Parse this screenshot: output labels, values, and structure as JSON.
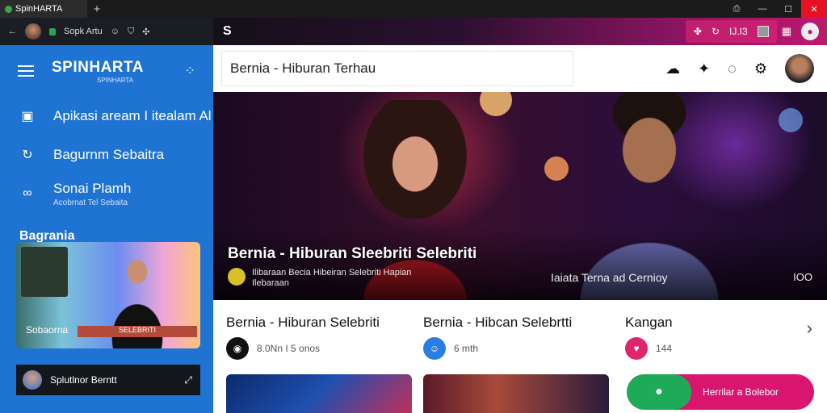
{
  "window": {
    "tab_title": "SpinHARTA",
    "new_tab": "+",
    "controls": [
      "⎙",
      "—",
      "☐",
      "✕"
    ]
  },
  "sidebar": {
    "profile_text": "Sopk Artu",
    "brand": "SPINHARTA",
    "brand_sub": "SPINHARTA",
    "items": [
      {
        "label": "Apikasi aream I itealam Al",
        "icon": "app-icon"
      },
      {
        "label": "Bagurnm Sebaitra",
        "icon": "refresh-icon"
      },
      {
        "label": "Sonai Plamh",
        "sub": "Acobrnat Tel Sebaita",
        "icon": "link-icon"
      }
    ],
    "section_title": "Bagrania",
    "card_label": "Sobaorna",
    "card_banner": "SELEBRITI",
    "bottom_text": "Splutlnor Berntt"
  },
  "header": {
    "logo": "S",
    "action_text": "IJ.I3",
    "search_value": "Bernia - Hiburan Terhau"
  },
  "hero": {
    "title": "Bernia - Hiburan Sleebriti Selebriti",
    "meta_line1": "Ilibaraan Becia  Hibeiran Selebriti  Hapian",
    "meta_line2": "Ilebaraan",
    "right_text": "Iaiata Terna ad Cernioy",
    "more": "IOO"
  },
  "cards": [
    {
      "title": "Bernia - Hiburan Selebriti",
      "meta": "8.0Nn I 5 onos",
      "icon_color": "#111111"
    },
    {
      "title": "Bernia - Hibcan Selebrtti",
      "meta": "6 mth",
      "icon_color": "#2a7de1"
    },
    {
      "title": "Kangan",
      "meta": "144",
      "icon_color": "#e0246e"
    }
  ],
  "cta": {
    "label": "Herrilar a Bolebor"
  },
  "colors": {
    "sidebar": "#1f73d2",
    "accent": "#d8166f",
    "cta_green": "#1faa57"
  }
}
